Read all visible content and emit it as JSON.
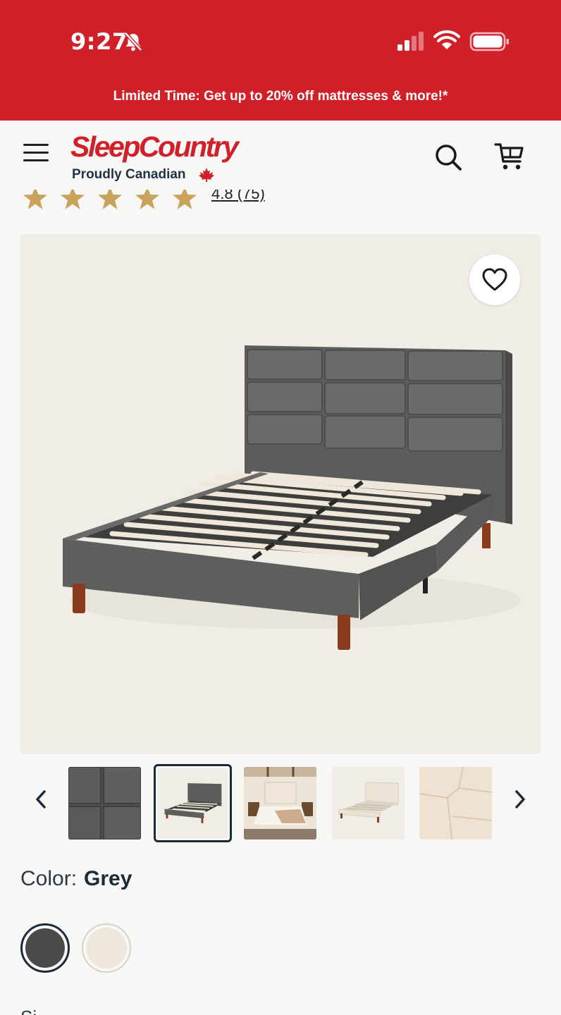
{
  "status_bar": {
    "time": "9:27"
  },
  "promo": {
    "text": "Limited Time: Get up to 20% off mattresses & more!*"
  },
  "header": {
    "logo_text": "SleepCountry",
    "logo_tagline": "Proudly Canadian"
  },
  "rating": {
    "stars": 5,
    "value_text": "4.8 (75)"
  },
  "product": {
    "thumbnails": [
      "headboard-detail",
      "bed-frame-grey",
      "bedroom-scene",
      "bed-frame-beige",
      "beige-detail"
    ],
    "active_thumbnail": 1
  },
  "color": {
    "label": "Color:",
    "value": "Grey",
    "options": [
      "Grey",
      "Beige"
    ]
  },
  "size": {
    "label_peek": "Si"
  },
  "colors": {
    "brand_red": "#d0202a",
    "navy": "#1c2a3a",
    "star_gold": "#c9a35c"
  }
}
